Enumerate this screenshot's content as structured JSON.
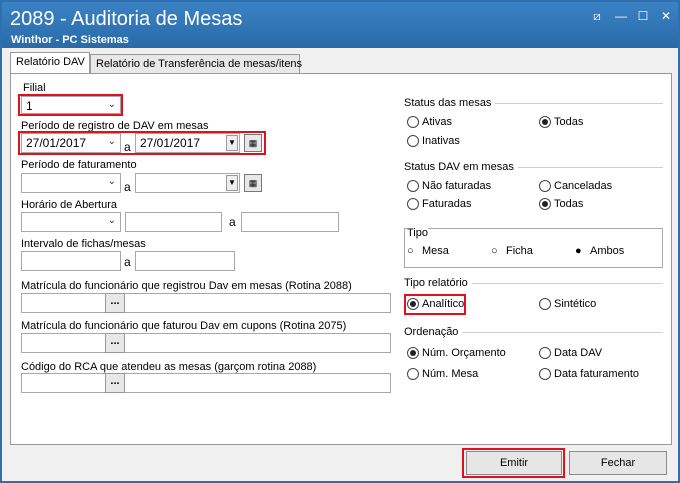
{
  "window": {
    "title": "2089 - Auditoria de Mesas",
    "subtitle": "Winthor - PC Sistemas",
    "controls": [
      "⧄",
      "—",
      "☐",
      "✕"
    ]
  },
  "tabs": [
    {
      "label": "Relatório DAV",
      "active": true
    },
    {
      "label": "Relatório de Transferência de mesas/itens",
      "active": false
    }
  ],
  "form": {
    "filial_label": "Filial",
    "filial_value": "1",
    "periodo_dav_label": "Período de registro de DAV em mesas",
    "periodo_dav_from": "27/01/2017",
    "periodo_dav_sep": "a",
    "periodo_dav_to": "27/01/2017",
    "periodo_fat_label": "Período de faturamento",
    "periodo_fat_sep": "a",
    "horario_label": "Horário de Abertura",
    "horario_sep": "a",
    "intervalo_label": "Intervalo de fichas/mesas",
    "intervalo_sep": "a",
    "matricula_dav_label": "Matrícula do funcionário que registrou Dav em mesas (Rotina 2088)",
    "matricula_fat_label": "Matrícula do funcionário que faturou Dav em cupons (Rotina 2075)",
    "rca_label": "Código do RCA que atendeu as mesas (garçom rotina 2088)",
    "dots": "..."
  },
  "status_mesas": {
    "title": "Status das mesas",
    "options": [
      {
        "label": "Ativas",
        "selected": false
      },
      {
        "label": "Todas",
        "selected": true
      },
      {
        "label": "Inativas",
        "selected": false
      }
    ]
  },
  "status_dav": {
    "title": "Status DAV em mesas",
    "options": [
      {
        "label": "Não faturadas",
        "selected": false
      },
      {
        "label": "Canceladas",
        "selected": false
      },
      {
        "label": "Faturadas",
        "selected": false
      },
      {
        "label": "Todas",
        "selected": true
      }
    ]
  },
  "tipo": {
    "title": "Tipo",
    "options": [
      {
        "label": "Mesa",
        "selected": false
      },
      {
        "label": "Ficha",
        "selected": false
      },
      {
        "label": "Ambos",
        "selected": true
      }
    ]
  },
  "tipo_relatorio": {
    "title": "Tipo relatório",
    "options": [
      {
        "label": "Analítico",
        "selected": true
      },
      {
        "label": "Sintético",
        "selected": false
      }
    ]
  },
  "ordenacao": {
    "title": "Ordenação",
    "options": [
      {
        "label": "Núm. Orçamento",
        "selected": true
      },
      {
        "label": "Data DAV",
        "selected": false
      },
      {
        "label": "Núm. Mesa",
        "selected": false
      },
      {
        "label": "Data faturamento",
        "selected": false
      }
    ]
  },
  "buttons": {
    "emitir": "Emitir",
    "fechar": "Fechar"
  },
  "colors": {
    "titlebar": "#2f6fae",
    "highlight": "#e0111b"
  }
}
